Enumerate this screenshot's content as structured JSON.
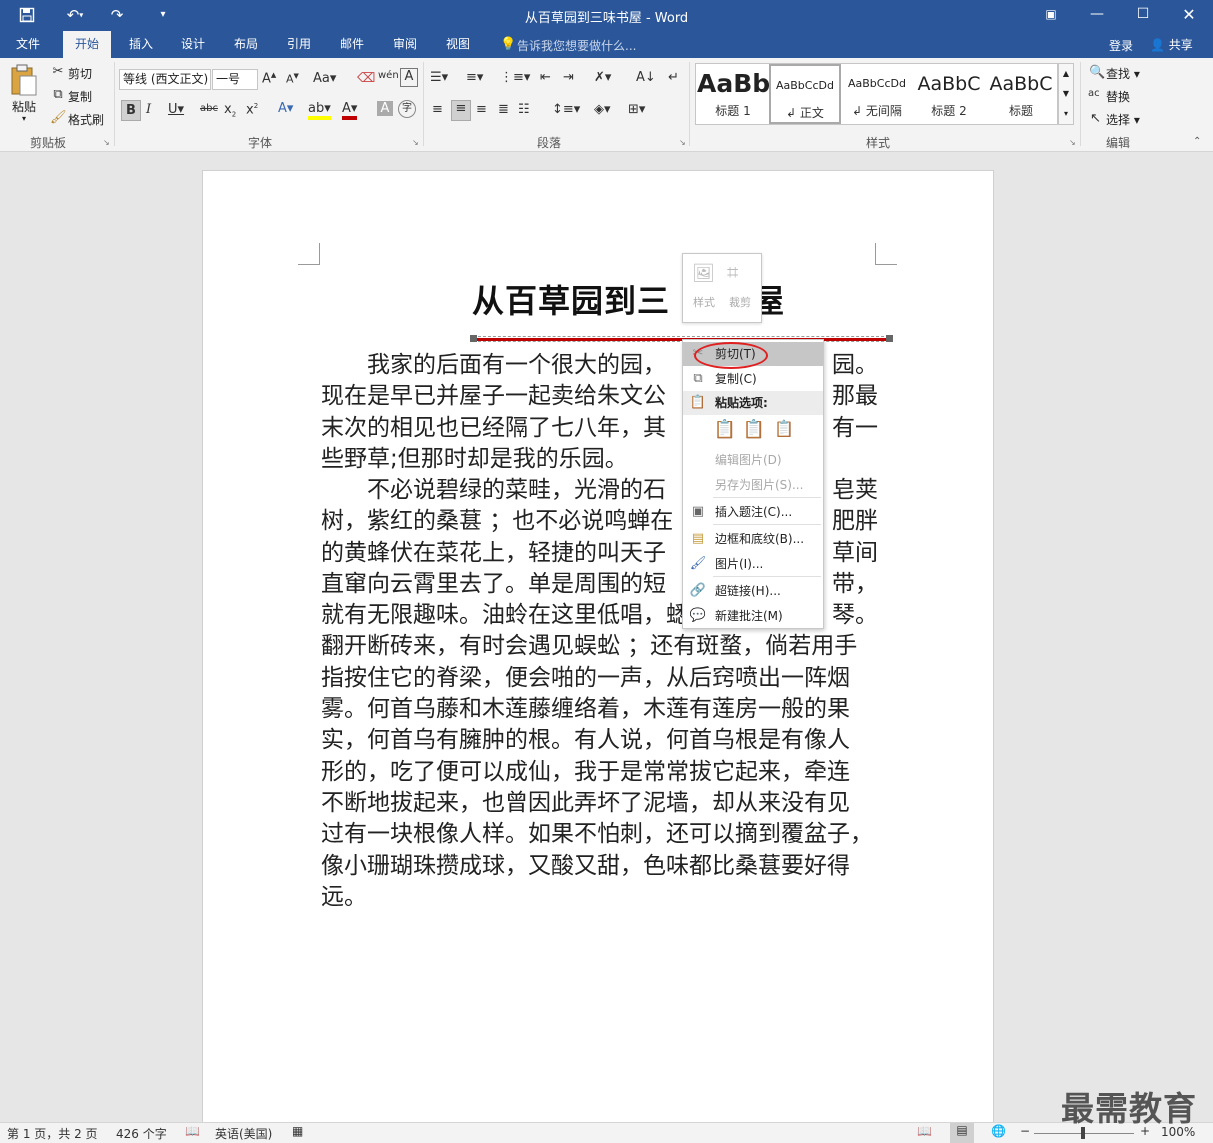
{
  "window": {
    "title": "从百草园到三味书屋 - Word"
  },
  "qat": {
    "save_icon": "save-icon",
    "undo_icon": "undo-icon",
    "redo_icon": "redo-icon"
  },
  "tabs": [
    {
      "label": "文件"
    },
    {
      "label": "开始"
    },
    {
      "label": "插入"
    },
    {
      "label": "设计"
    },
    {
      "label": "布局"
    },
    {
      "label": "引用"
    },
    {
      "label": "邮件"
    },
    {
      "label": "审阅"
    },
    {
      "label": "视图"
    }
  ],
  "tellme": {
    "placeholder": "告诉我您想要做什么..."
  },
  "account": {
    "login": "登录",
    "share": "共享"
  },
  "ribbon": {
    "clipboard": {
      "paste": "粘贴",
      "cut": "剪切",
      "copy": "复制",
      "format_painter": "格式刷",
      "label": "剪贴板"
    },
    "font": {
      "font_name": "等线 (西文正文)",
      "font_size": "一号",
      "label": "字体"
    },
    "paragraph": {
      "label": "段落"
    },
    "styles": {
      "items": [
        {
          "preview": "AaBb",
          "name": "标题 1"
        },
        {
          "preview": "AaBbCcDd",
          "name": "正文"
        },
        {
          "preview": "AaBbCcDd",
          "name": "无间隔"
        },
        {
          "preview": "AaBbC",
          "name": "标题 2"
        },
        {
          "preview": "AaBbC",
          "name": "标题"
        }
      ],
      "label": "样式"
    },
    "editing": {
      "find": "查找",
      "replace": "替换",
      "select": "选择",
      "label": "编辑"
    }
  },
  "document": {
    "title": "从百草园到三味书屋",
    "title_visible": "从百草园到三",
    "title_tail": "屋",
    "paragraph1": [
      "　　我家的后面有一个很大的园，",
      "现在是早已并屋子一起卖给朱文公",
      "末次的相见也已经隔了七八年，其",
      "些野草;但那时却是我的乐园。"
    ],
    "paragraph1_right": [
      "园。",
      "那最",
      "有一",
      ""
    ],
    "paragraph2": [
      "　　不必说碧绿的菜畦，光滑的石",
      "树，紫红的桑葚 ；也不必说鸣蝉在",
      "的黄蜂伏在菜花上，轻捷的叫天子",
      "直窜向云霄里去了。单是周围的短",
      "就有无限趣味。油蛉在这里低唱，蟋",
      "翻开断砖来，有时会遇见蜈蚣 ；还有斑蝥，倘若用手",
      "指按住它的脊梁，便会啪的一声，从后窍喷出一阵烟",
      "雾。何首乌藤和木莲藤缠络着，木莲有莲房一般的果",
      "实，何首乌有臃肿的根。有人说，何首乌根是有像人",
      "形的，吃了便可以成仙，我于是常常拔它起来，牵连",
      "不断地拔起来，也曾因此弄坏了泥墙，却从来没有见",
      "过有一块根像人样。如果不怕刺，还可以摘到覆盆子，",
      "像小珊瑚珠攒成球，又酸又甜，色味都比桑葚要好得",
      "远。"
    ],
    "paragraph2_right": [
      "皂荚",
      "肥胖",
      "草间",
      "带，",
      "琴。"
    ]
  },
  "mini_toolbar": {
    "style_label": "样式",
    "crop_label": "裁剪"
  },
  "context_menu": {
    "cut": "剪切(T)",
    "copy": "复制(C)",
    "paste_options": "粘贴选项:",
    "edit_picture": "编辑图片(D)",
    "save_as_picture": "另存为图片(S)...",
    "insert_caption": "插入题注(C)...",
    "borders_shading": "边框和底纹(B)...",
    "picture": "图片(I)...",
    "hyperlink": "超链接(H)...",
    "new_comment": "新建批注(M)"
  },
  "status": {
    "page": "第 1 页，共 2 页",
    "words": "426 个字",
    "language": "英语(美国)",
    "zoom": "100%"
  },
  "watermark": "最需教育",
  "colors": {
    "accent": "#2b579a",
    "highlight_circle": "#e02020",
    "selection_line": "#c00000"
  }
}
